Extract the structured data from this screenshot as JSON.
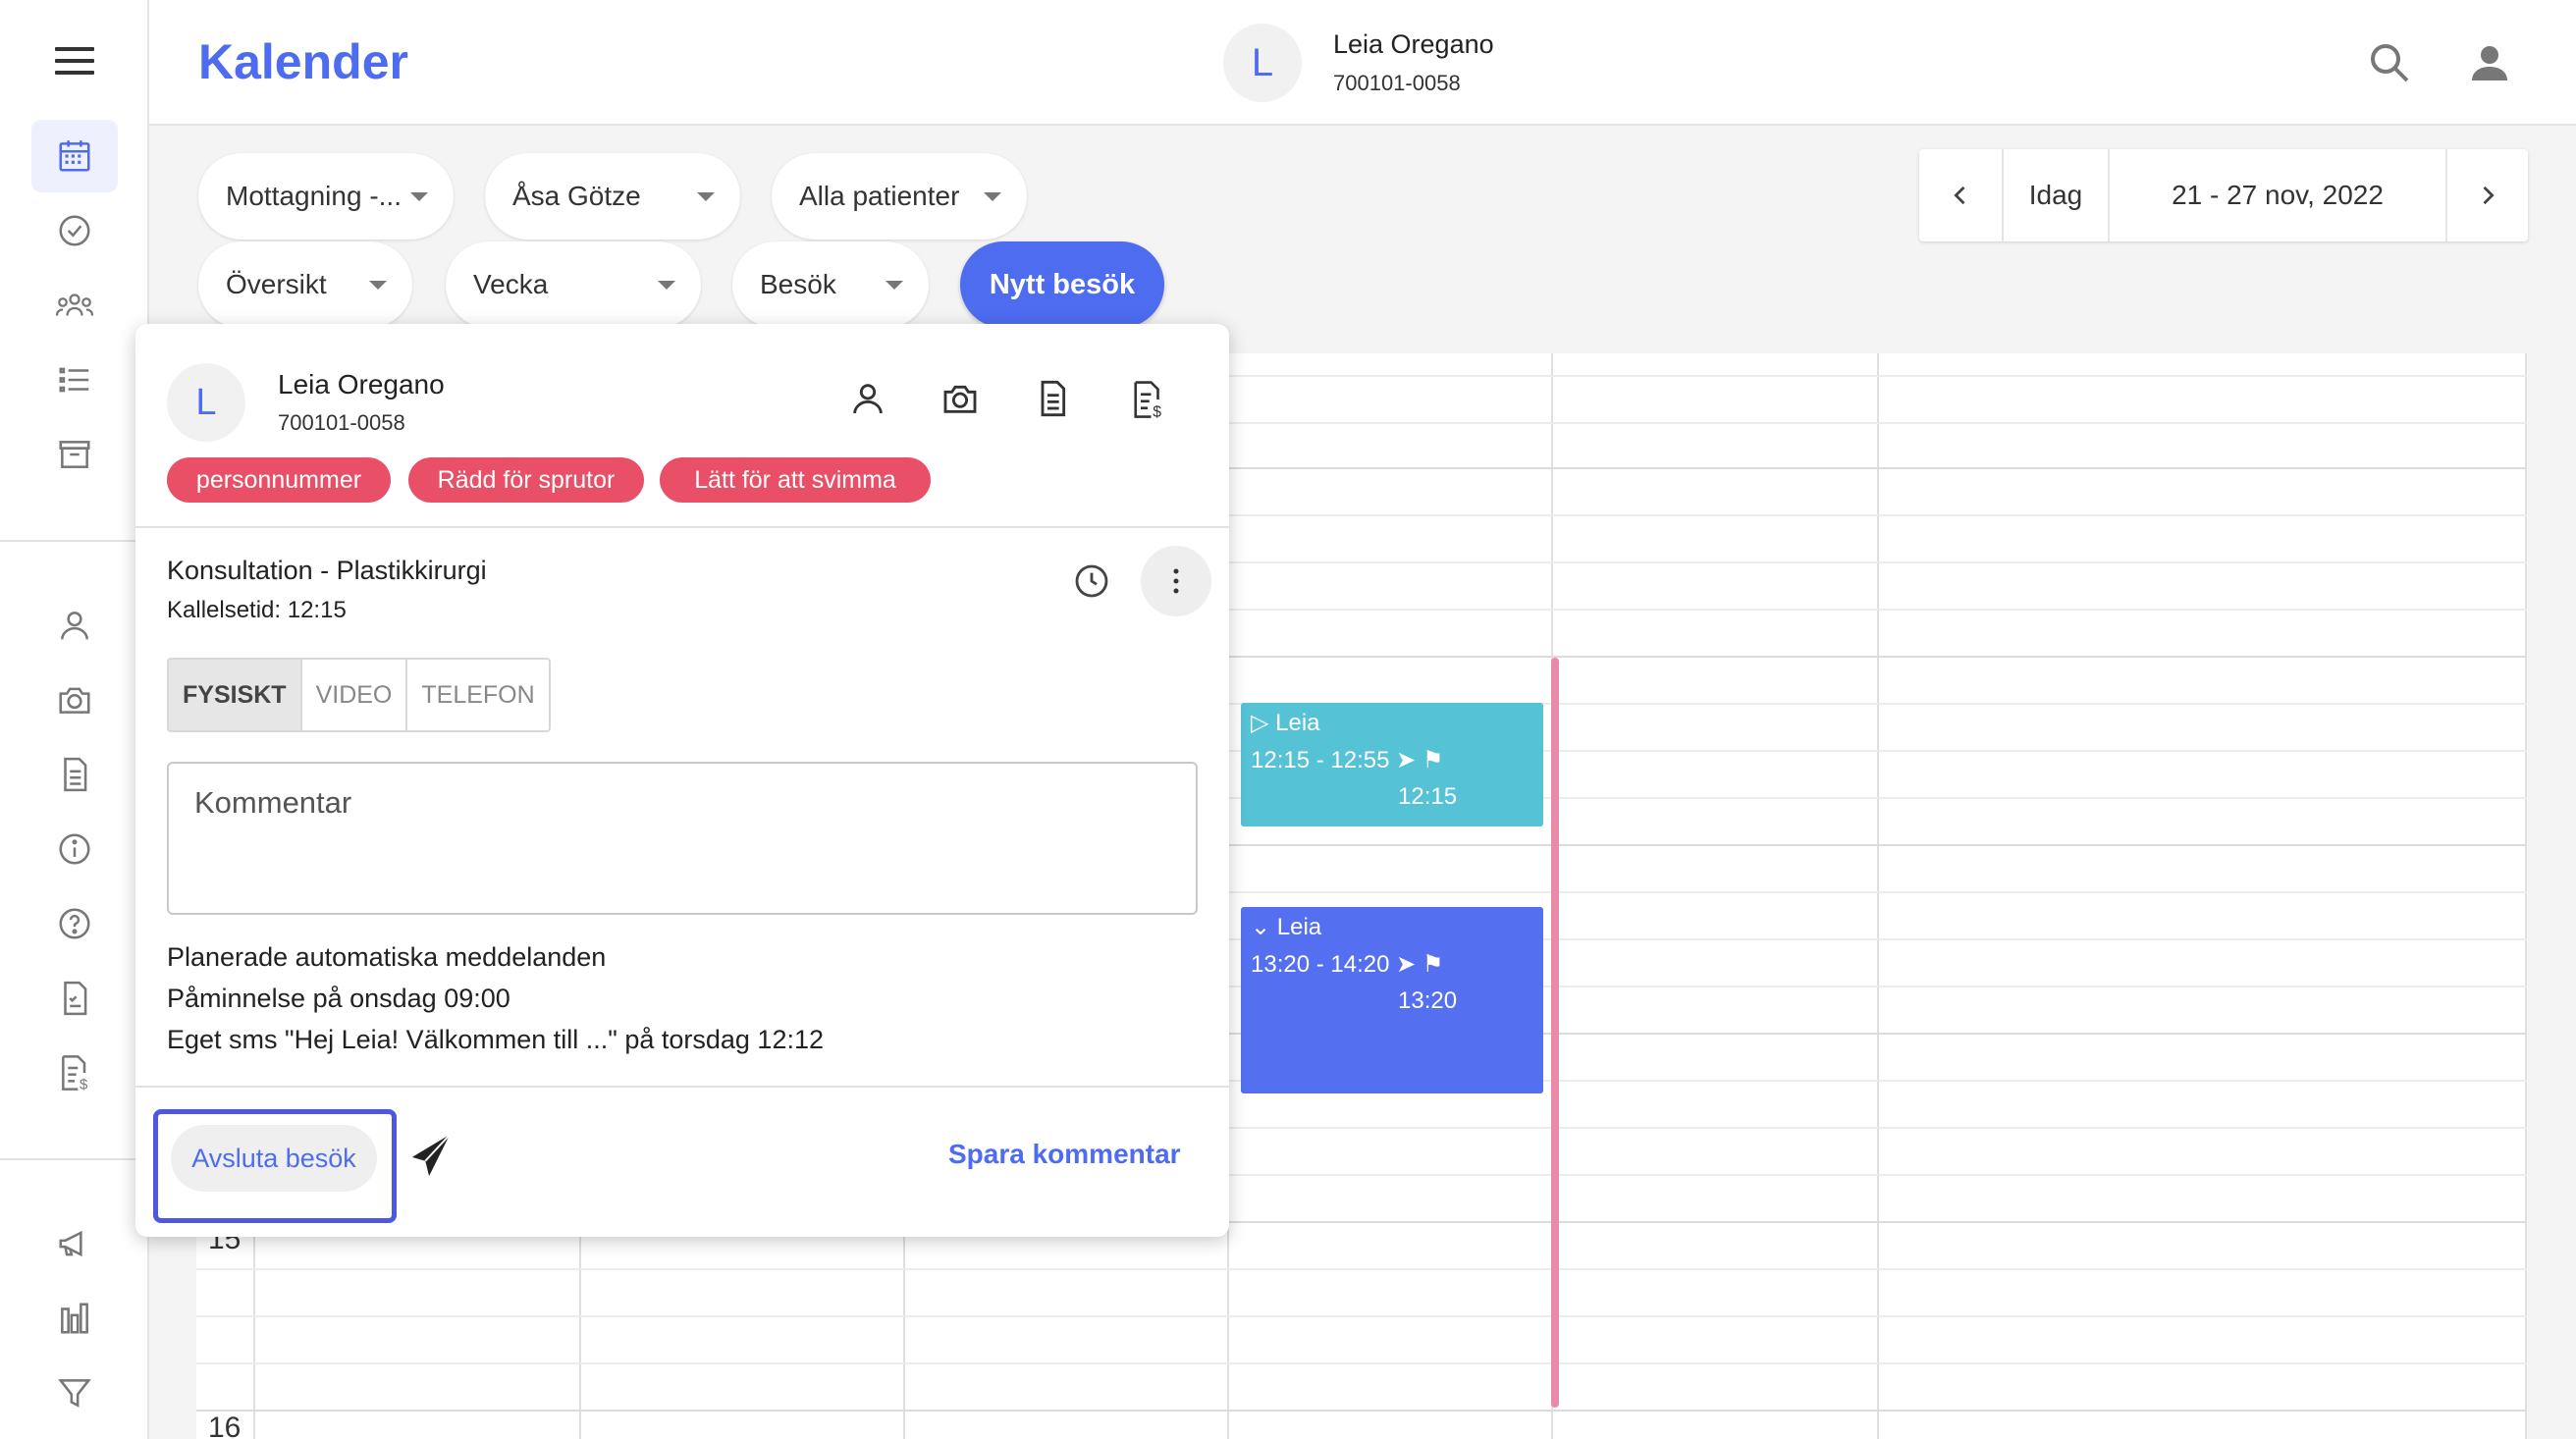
{
  "header": {
    "app_title": "Kalender",
    "patient_initial": "L",
    "patient_name": "Leia Oregano",
    "patient_id": "700101-0058"
  },
  "filters": {
    "row1": [
      "Mottagning -...",
      "Åsa Götze",
      "Alla patienter"
    ],
    "row2": [
      "Översikt",
      "Vecka",
      "Besök"
    ],
    "new_visit_label": "Nytt besök"
  },
  "datenav": {
    "today_label": "Idag",
    "range": "21 - 27 nov, 2022"
  },
  "calendar": {
    "hour_labels": [
      "15",
      "16"
    ]
  },
  "events": [
    {
      "name": "Leia",
      "time": "12:15 - 12:55",
      "callout": "12:15",
      "color": "#55c2d6",
      "state": "collapsed"
    },
    {
      "name": "Leia",
      "time": "13:20 - 14:20",
      "callout": "13:20",
      "color": "#5470f0",
      "state": "expanded"
    }
  ],
  "popup": {
    "initial": "L",
    "name": "Leia Oregano",
    "id": "700101-0058",
    "tags": [
      "personnummer",
      "Rädd för sprutor",
      "Lätt för att svimma"
    ],
    "tag_color": "#e94f67",
    "visit_type": "Konsultation - Plastikkirurgi",
    "callout_time": "Kallelsetid: 12:15",
    "modes": [
      "FYSISKT",
      "VIDEO",
      "TELEFON"
    ],
    "active_mode": "FYSISKT",
    "comment_placeholder": "Kommentar",
    "messages_title": "Planerade automatiska meddelanden",
    "messages": [
      "Påminnelse på onsdag 09:00",
      "Eget sms \"Hej Leia! Välkommen till ...\" på torsdag 12:12"
    ],
    "end_visit_label": "Avsluta besök",
    "save_comment_label": "Spara kommentar"
  },
  "colors": {
    "accent": "#4e6cf0",
    "now_line": "#e88aa8"
  }
}
